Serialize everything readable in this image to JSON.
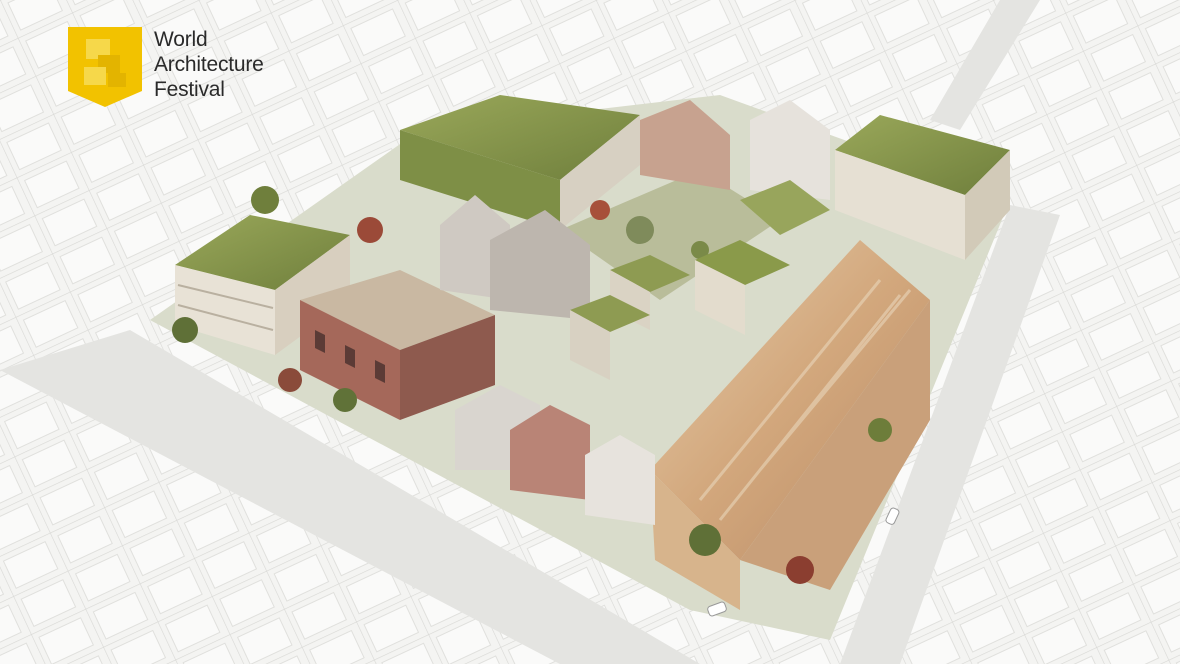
{
  "logo": {
    "line1": "World",
    "line2": "Architecture",
    "line3": "Festival",
    "mark_color": "#f2c200"
  },
  "scene": {
    "background_color": "#ededeb",
    "building_color": "#f7f7f5",
    "roof_garden_color": "#8a9a4a",
    "brick_color": "#a5685a",
    "timber_color": "#d7b48c"
  }
}
